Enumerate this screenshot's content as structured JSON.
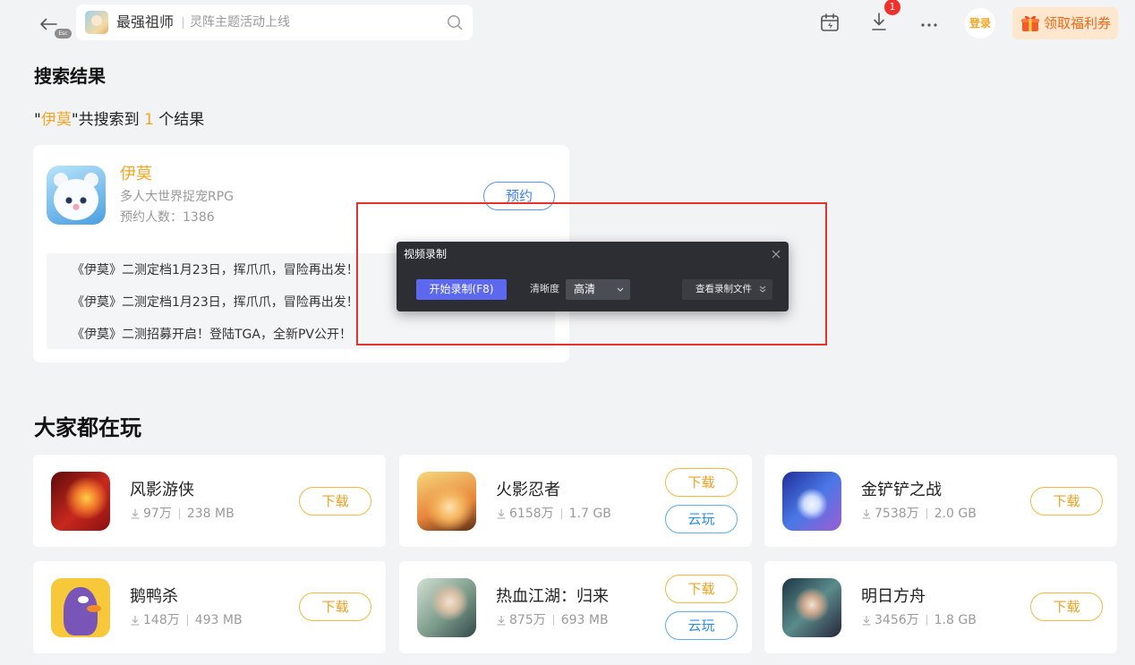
{
  "topbar": {
    "back_icon": "back-arrow-icon",
    "esc_badge": "Esc",
    "search": {
      "game_name": "最强祖师",
      "hint": "灵阵主题活动上线",
      "icon": "search-icon"
    },
    "calendar_icon": "calendar-icon",
    "download_icon": "download-icon",
    "download_badge": "1",
    "more_icon": "more-icon",
    "login_label": "登录",
    "coupon_icon": "gift-icon",
    "coupon_label": "领取福利券"
  },
  "search_results": {
    "heading": "搜索结果",
    "summary": {
      "open_quote": "\"",
      "keyword": "伊莫",
      "middle": "\"共搜索到 ",
      "count": "1",
      "tail": " 个结果"
    },
    "results": [
      {
        "title": "伊莫",
        "subtitle": "多人大世界捉宠RPG",
        "reservations": "预约人数：1386",
        "reserve_label": "预约",
        "news": [
          "《伊莫》二测定档1月23日，挥爪爪，冒险再出发！",
          "《伊莫》二测定档1月23日，挥爪爪，冒险再出发！",
          "《伊莫》二测招募开启！登陆TGA，全新PV公开！"
        ]
      }
    ]
  },
  "recorder": {
    "title": "视频录制",
    "close_icon": "close-icon",
    "start_label": "开始录制(F8)",
    "quality_label": "清晰度",
    "quality_value": "高清",
    "view_files_label": "查看录制文件"
  },
  "popular": {
    "heading": "大家都在玩",
    "games": [
      {
        "name": "风影游侠",
        "downloads": "97万",
        "size": "238 MB",
        "download_label": "下载"
      },
      {
        "name": "火影忍者",
        "downloads": "6158万",
        "size": "1.7 GB",
        "download_label": "下载",
        "cloud_label": "云玩"
      },
      {
        "name": "金铲铲之战",
        "downloads": "7538万",
        "size": "2.0 GB",
        "download_label": "下载"
      },
      {
        "name": "鹅鸭杀",
        "downloads": "148万",
        "size": "493 MB",
        "download_label": "下载"
      },
      {
        "name": "热血江湖：归来",
        "downloads": "875万",
        "size": "693 MB",
        "download_label": "下载",
        "cloud_label": "云玩"
      },
      {
        "name": "明日方舟",
        "downloads": "3456万",
        "size": "1.8 GB",
        "download_label": "下载"
      }
    ]
  },
  "colors": {
    "page_background": "#f2f3f5",
    "accent_orange": "#f5a623",
    "download_button": "#f0a020",
    "cloud_button": "#2a8ee8",
    "reserve_button": "#3b7ff0",
    "badge_red": "#f0302a",
    "record_button": "#5c68ee",
    "highlight_box_red": "#e6322b",
    "recorder_background": "#2c2e34"
  }
}
